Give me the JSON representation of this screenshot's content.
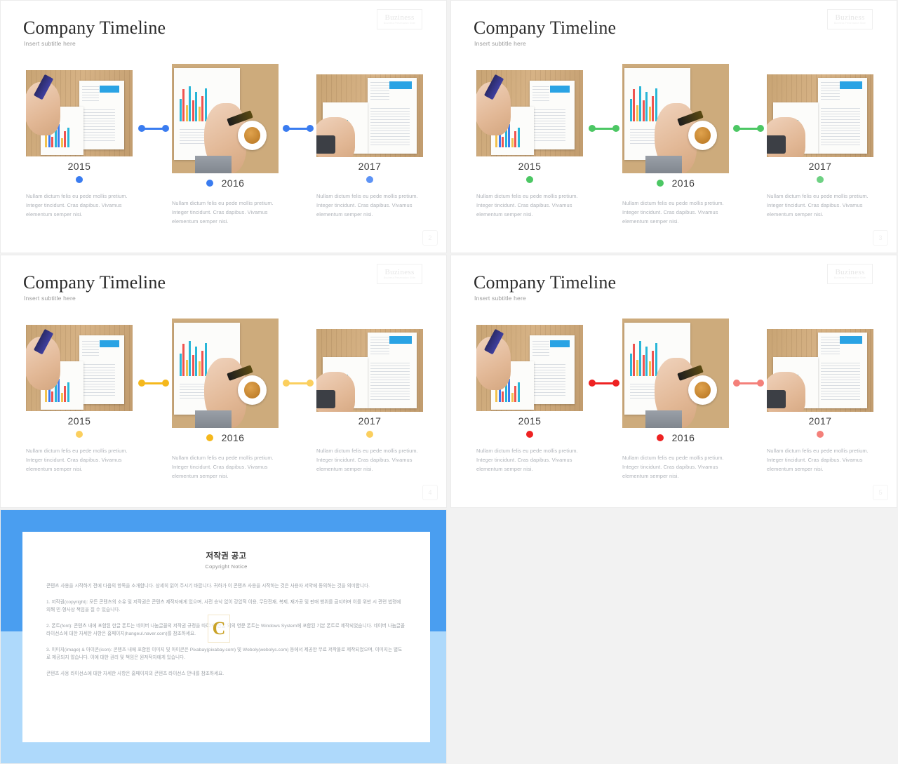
{
  "slides": [
    {
      "title": "Company Timeline",
      "subtitle": "Insert subtitle here",
      "page_number": "2",
      "accent": "#3a7cf0",
      "accent_soft": "#5d93f5",
      "logo": {
        "name": "Buziness",
        "tagline": "Business Presentation Slide"
      },
      "milestones": [
        {
          "year": "2015",
          "text": "Nullam dictum felis eu pede mollis pretium. Integer tincidunt. Cras dapibus. Vivamus elementum semper nisi."
        },
        {
          "year": "2016",
          "text": "Nullam dictum felis eu pede mollis pretium. Integer tincidunt. Cras dapibus. Vivamus elementum semper nisi."
        },
        {
          "year": "2017",
          "text": "Nullam dictum felis eu pede mollis pretium. Integer tincidunt. Cras dapibus. Vivamus elementum semper nisi."
        }
      ]
    },
    {
      "title": "Company Timeline",
      "subtitle": "Insert subtitle here",
      "page_number": "3",
      "accent": "#4cc764",
      "accent_soft": "#6ed183",
      "logo": {
        "name": "Buziness",
        "tagline": "Business Presentation Slide"
      },
      "milestones": [
        {
          "year": "2015",
          "text": "Nullam dictum felis eu pede mollis pretium. Integer tincidunt. Cras dapibus. Vivamus elementum semper nisi."
        },
        {
          "year": "2016",
          "text": "Nullam dictum felis eu pede mollis pretium. Integer tincidunt. Cras dapibus. Vivamus elementum semper nisi."
        },
        {
          "year": "2017",
          "text": "Nullam dictum felis eu pede mollis pretium. Integer tincidunt. Cras dapibus. Vivamus elementum semper nisi."
        }
      ]
    },
    {
      "title": "Company Timeline",
      "subtitle": "Insert subtitle here",
      "page_number": "4",
      "accent": "#f5b81c",
      "accent_soft": "#fbcf5e",
      "logo": {
        "name": "Buziness",
        "tagline": "Business Presentation Slide"
      },
      "milestones": [
        {
          "year": "2015",
          "text": "Nullam dictum felis eu pede mollis pretium. Integer tincidunt. Cras dapibus. Vivamus elementum semper nisi."
        },
        {
          "year": "2016",
          "text": "Nullam dictum felis eu pede mollis pretium. Integer tincidunt. Cras dapibus. Vivamus elementum semper nisi."
        },
        {
          "year": "2017",
          "text": "Nullam dictum felis eu pede mollis pretium. Integer tincidunt. Cras dapibus. Vivamus elementum semper nisi."
        }
      ]
    },
    {
      "title": "Company Timeline",
      "subtitle": "Insert subtitle here",
      "page_number": "5",
      "accent": "#ee2222",
      "accent_soft": "#f4807a",
      "logo": {
        "name": "Buziness",
        "tagline": "Business Presentation Slide"
      },
      "milestones": [
        {
          "year": "2015",
          "text": "Nullam dictum felis eu pede mollis pretium. Integer tincidunt. Cras dapibus. Vivamus elementum semper nisi."
        },
        {
          "year": "2016",
          "text": "Nullam dictum felis eu pede mollis pretium. Integer tincidunt. Cras dapibus. Vivamus elementum semper nisi."
        },
        {
          "year": "2017",
          "text": "Nullam dictum felis eu pede mollis pretium. Integer tincidunt. Cras dapibus. Vivamus elementum semper nisi."
        }
      ]
    }
  ],
  "copyright": {
    "title": "저작권 공고",
    "subtitle": "Copyright Notice",
    "watermark": "C",
    "border_color": "#4a9ef0",
    "band_color": "#aed9fb",
    "intro": "콘텐츠 사용을 시작하기 전에 다음의 항목을 소개합니다. 상세히 읽어 주시기 바랍니다. 귀하가 이 콘텐츠 사용을 시작하는 것은 사용자 서약에 동의하는 것을 의미합니다.",
    "items": [
      "1. 저작권(copyright): 모든 콘텐츠의 소유 및 저작권은 콘텐츠 제작자에게 있으며, 사전 승낙 없이 강압적 이용, 무단전재, 복제, 재가공 및 판매 행위를 금지하며 이를 위반 시 관련 법령에 의해 민·형사상 책임을 질 수 있습니다.",
      "2. 폰트(font): 콘텐츠 내에 포함된 한글 폰트는 네이버 나눔글꼴의 저작권 규정을 따르며, 한글 외의 영문 폰트는 Windows System에 포함된 기본 폰트로 제작되었습니다. 네이버 나눔글꼴 라이선스에 대한 자세한 사항은 홈페이지(hangeul.naver.com)를 참조하세요.",
      "3. 이미지(image) & 아이콘(icon): 콘텐츠 내에 포함된 이미지 및 아이콘은 Pixabay(pixabay.com) 및 Weboly(webolys.com) 등에서 제공한 무료 저작물로 제작되었으며, 이미지는 별도로 제공되지 않습니다. 이에 대한 권리 및 책임은 원저작자에게 있습니다.",
      "콘텐츠 사용 라이선스에 대한 자세한 사항은 홈페이지의 콘텐츠 라이선스 안내를 참조하세요."
    ]
  }
}
